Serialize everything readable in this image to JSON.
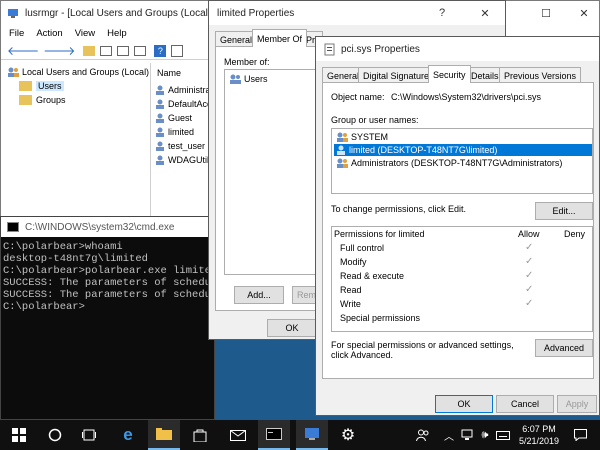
{
  "mmc": {
    "title": "lusrmgr - [Local Users and Groups (Local)\\Users]",
    "menu": [
      "File",
      "Action",
      "View",
      "Help"
    ],
    "tree_root": "Local Users and Groups (Local)",
    "tree_children": [
      "Users",
      "Groups"
    ],
    "list_header": "Name",
    "users": [
      "Administrator",
      "DefaultAccount",
      "Guest",
      "limited",
      "test_user",
      "WDAGUtilityAccount"
    ]
  },
  "limited_props": {
    "title": "limited Properties",
    "tabs": [
      "General",
      "Member Of",
      "Profile"
    ],
    "member_of_label": "Member of:",
    "members": [
      "Users"
    ],
    "add_button": "Add...",
    "remove_button": "Remove",
    "ok_button": "OK"
  },
  "cmd": {
    "title": "C:\\WINDOWS\\system32\\cmd.exe",
    "lines": [
      "C:\\polarbear>whoami",
      "desktop-t48nt7g\\limited",
      "",
      "C:\\polarbear>polarbear.exe limited",
      "SUCCESS: The parameters of schedule",
      "SUCCESS: The parameters of schedule",
      "",
      "C:\\polarbear>"
    ]
  },
  "pci": {
    "title": "pci.sys Properties",
    "tabs": [
      "General",
      "Digital Signatures",
      "Security",
      "Details",
      "Previous Versions"
    ],
    "object_name_label": "Object name:",
    "object_name": "C:\\Windows\\System32\\drivers\\pci.sys",
    "group_label": "Group or user names:",
    "groups": [
      "SYSTEM",
      "limited (DESKTOP-T48NT7G\\limited)",
      "Administrators (DESKTOP-T48NT7G\\Administrators)"
    ],
    "change_text": "To change permissions, click Edit.",
    "edit_button": "Edit...",
    "perm_header": "Permissions for limited",
    "allow_label": "Allow",
    "deny_label": "Deny",
    "permissions": [
      "Full control",
      "Modify",
      "Read & execute",
      "Read",
      "Write",
      "Special permissions"
    ],
    "allowed": [
      true,
      true,
      true,
      true,
      true,
      false
    ],
    "special_text": "For special permissions or advanced settings, click Advanced.",
    "advanced_button": "Advanced",
    "ok_button": "OK",
    "cancel_button": "Cancel",
    "apply_button": "Apply"
  },
  "taskbar": {
    "time": "6:07 PM",
    "date": "5/21/2019"
  }
}
